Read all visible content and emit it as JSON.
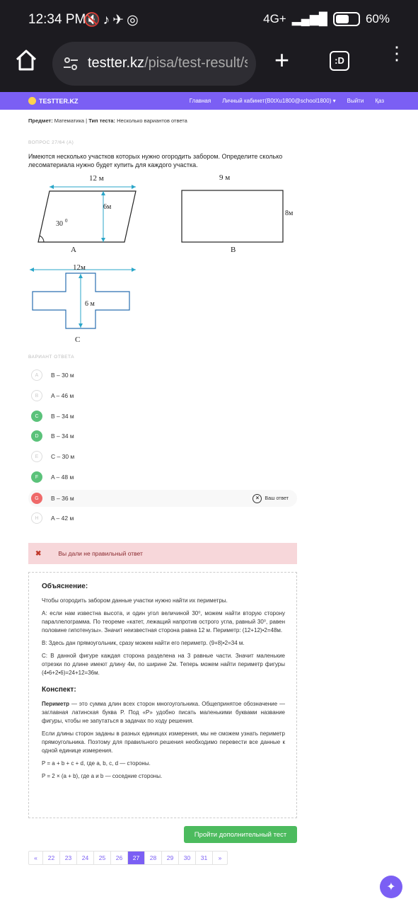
{
  "status": {
    "time": "12:34 PM",
    "network": "4G+",
    "battery": "60%"
  },
  "browser": {
    "url_domain": "testter.kz",
    "url_path": "/pisa/test-result/s",
    "tabs_label": ":D"
  },
  "nav": {
    "logo": "TESTTER.KZ",
    "links": [
      "Главная",
      "Личный кабинет(B0tXu1800@school1800)",
      "Выйти",
      "Қаз"
    ]
  },
  "meta": {
    "subject_label": "Предмет:",
    "subject_value": "Математика",
    "type_label": "Тип теста:",
    "type_value": "Несколько вариантов ответа"
  },
  "question": {
    "number": "ВОПРОС 27/64 (А)",
    "text": "Имеются несколько участков которых нужно огородить забором. Определите сколько лесоматериала нужно будет купить для каждого участка."
  },
  "figures": {
    "a_top": "12 м",
    "a_height": "6м",
    "a_angle": "30",
    "a_angle_sup": "0",
    "a_label": "A",
    "b_top": "9 м",
    "b_right": "8м",
    "b_label": "B",
    "c_top": "12м",
    "c_height": "6 м",
    "c_label": "C"
  },
  "answers_label": "ВАРИАНТ ОТВЕТА",
  "options": [
    {
      "letter": "A",
      "text": "B – 30 м"
    },
    {
      "letter": "B",
      "text": "A – 46 м"
    },
    {
      "letter": "C",
      "text": "B – 34 м"
    },
    {
      "letter": "D",
      "text": "B – 34 м"
    },
    {
      "letter": "E",
      "text": "C – 30 м"
    },
    {
      "letter": "F",
      "text": "A – 48 м"
    },
    {
      "letter": "G",
      "text": "B – 36 м"
    },
    {
      "letter": "H",
      "text": "A – 42 м"
    }
  ],
  "your_answer": "Ваш ответ",
  "alert": "Вы дали не правильный ответ",
  "explanation": {
    "title": "Объяснение:",
    "p1": "Чтобы огородить забором данные участки нужно найти их периметры.",
    "p2": "A: если нам известна высота, и один угол величиной 30⁰, можем найти вторую сторону параллелограмма. По теореме «катет, лежащий напротив острого угла, равный 30⁰, равен половине гипотенузы». Значит неизвестная сторона равна 12 м. Периметр: (12+12)•2=48м.",
    "p3": "B: Здесь дан прямоугольник, сразу можем найти его периметр. (9+8)•2=34 м.",
    "p4": "C: В данной фигуре каждая сторона разделена на 3 равные части. Значит маленькие отрезки по длине имеют длину 4м, по ширине 2м. Теперь можем найти периметр фигуры (4•6+2•6)=24+12=36м.",
    "konspekt_title": "Конспект:",
    "k1_bold": "Периметр",
    "k1": " — это сумма длин всех сторон многоугольника. Общепринятое обозначение — заглавная латинская буква P. Под «P» удобно писать маленькими буквами название фигуры, чтобы не запутаться в задачах по ходу решения.",
    "k2": "Если длины сторон заданы в разных единицах измерения, мы не сможем узнать периметр прямоугольника. Поэтому для правильного решения необходимо перевести все данные к одной единице измерения.",
    "k3": "P = a + b + c + d, где a, b, c, d — стороны.",
    "k4": "P = 2 × (a + b), где a и b — соседние стороны."
  },
  "extra_button": "Пройти дополнительный тест",
  "pager": [
    "«",
    "22",
    "23",
    "24",
    "25",
    "26",
    "27",
    "28",
    "29",
    "30",
    "31",
    "»"
  ]
}
